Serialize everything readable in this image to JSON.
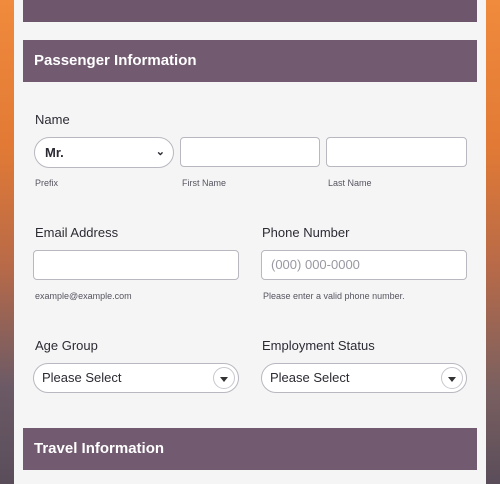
{
  "passenger_section": {
    "title": "Passenger Information"
  },
  "name_field": {
    "label": "Name",
    "prefix_value": "Mr.",
    "prefix_sublabel": "Prefix",
    "first_sublabel": "First Name",
    "last_sublabel": "Last Name"
  },
  "email_field": {
    "label": "Email Address",
    "sublabel": "example@example.com"
  },
  "phone_field": {
    "label": "Phone Number",
    "placeholder": "(000) 000-0000",
    "sublabel": "Please enter a valid phone number."
  },
  "age_group": {
    "label": "Age Group",
    "selected": "Please Select"
  },
  "employment_status": {
    "label": "Employment Status",
    "selected": "Please Select"
  },
  "travel_section": {
    "title": "Travel Information"
  },
  "icons": {
    "prefix_dropdown": "chevron-down-icon",
    "select_dropdown": "caret-down-icon"
  },
  "colors": {
    "header_bg": "#725a70",
    "accent_orange": "#e8803e"
  }
}
